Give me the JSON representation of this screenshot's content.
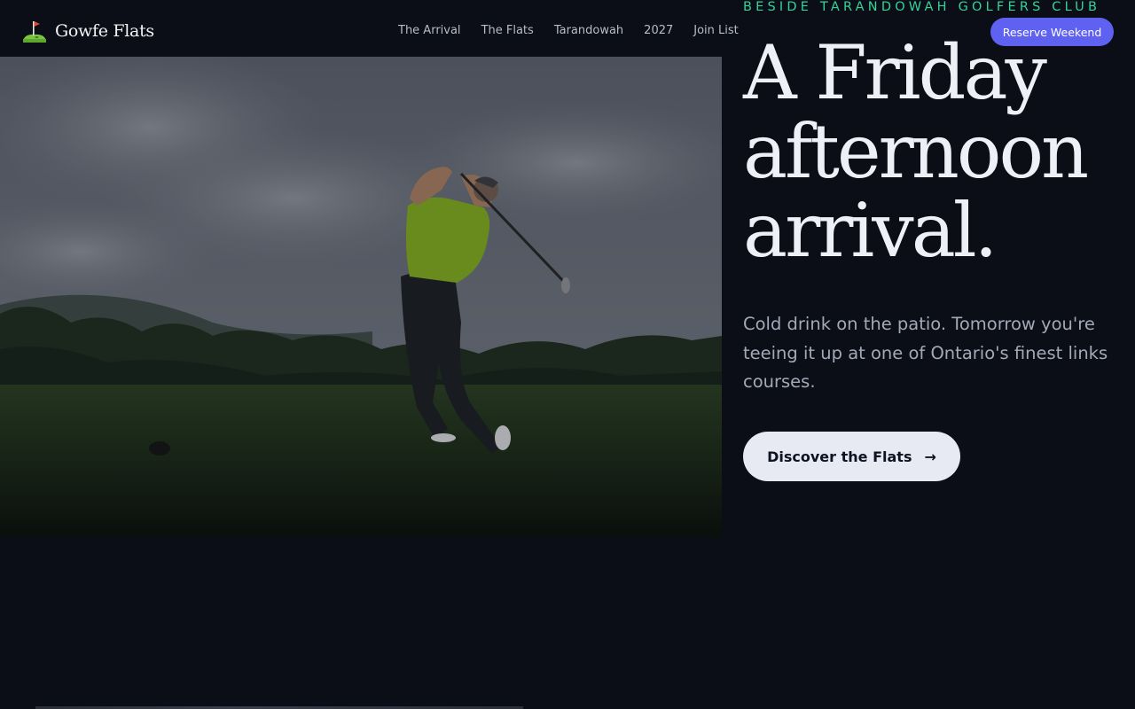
{
  "brand": {
    "name": "Gowfe Flats",
    "logo_icon": "golf-flag-icon"
  },
  "nav": {
    "items": [
      {
        "label": "The Arrival"
      },
      {
        "label": "The Flats"
      },
      {
        "label": "Tarandowah"
      },
      {
        "label": "2027"
      },
      {
        "label": "Join List"
      }
    ]
  },
  "header_cta": {
    "label": "Reserve Weekend"
  },
  "hero": {
    "eyebrow": "BESIDE TARANDOWAH GOLFERS CLUB",
    "headline": "A Friday afternoon arrival.",
    "lede": "Cold drink on the patio. Tomorrow you're teeing it up at one of Ontario's finest links courses.",
    "cta_label": "Discover the Flats",
    "cta_arrow": "→",
    "image_subject": "golfer-swing-photo"
  },
  "colors": {
    "background": "#0b0e16",
    "accent": "#5f61f0",
    "eyebrow": "#34d399",
    "headline": "#eef0f7",
    "lede": "#a4a9b7",
    "cta_bg": "#e7e9f3"
  }
}
